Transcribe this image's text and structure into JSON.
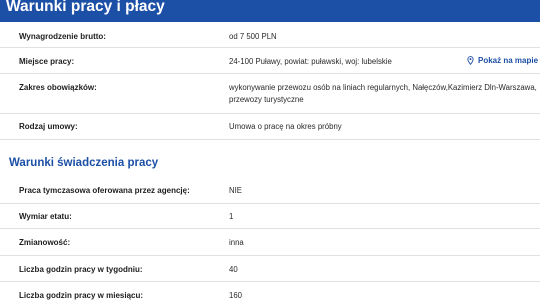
{
  "header": {
    "title": "Warunki pracy i płacy"
  },
  "work_conditions": {
    "salary_label": "Wynagrodzenie brutto:",
    "salary_value": "od 7 500 PLN",
    "location_label": "Miejsce pracy:",
    "location_value": "24-100 Puławy, powiat: puławski, woj: lubelskie",
    "map_link": "Pokaż na mapie",
    "duties_label": "Zakres obowiązków:",
    "duties_value_line1": "wykonywanie przewozu osób na liniach regularnych, Nałęczów,Kazimierz Dln-Warszawa,",
    "duties_value_line2": "przewozy turystyczne",
    "contract_label": "Rodzaj umowy:",
    "contract_value": "Umowa o pracę na okres próbny"
  },
  "employment_conditions": {
    "section_title": "Warunki świadczenia pracy",
    "temp_label": "Praca tymczasowa oferowana przez agencję:",
    "temp_value": "NIE",
    "fte_label": "Wymiar etatu:",
    "fte_value": "1",
    "shift_label": "Zmianowość:",
    "shift_value": "inna",
    "weekly_label": "Liczba godzin pracy w tygodniu:",
    "weekly_value": "40",
    "monthly_label": "Liczba godzin pracy w miesiącu:",
    "monthly_value": "160"
  },
  "colors": {
    "brand": "#1c4fa6",
    "divider": "#e1e1e1"
  },
  "icons": {
    "map": "map-pin-icon"
  }
}
